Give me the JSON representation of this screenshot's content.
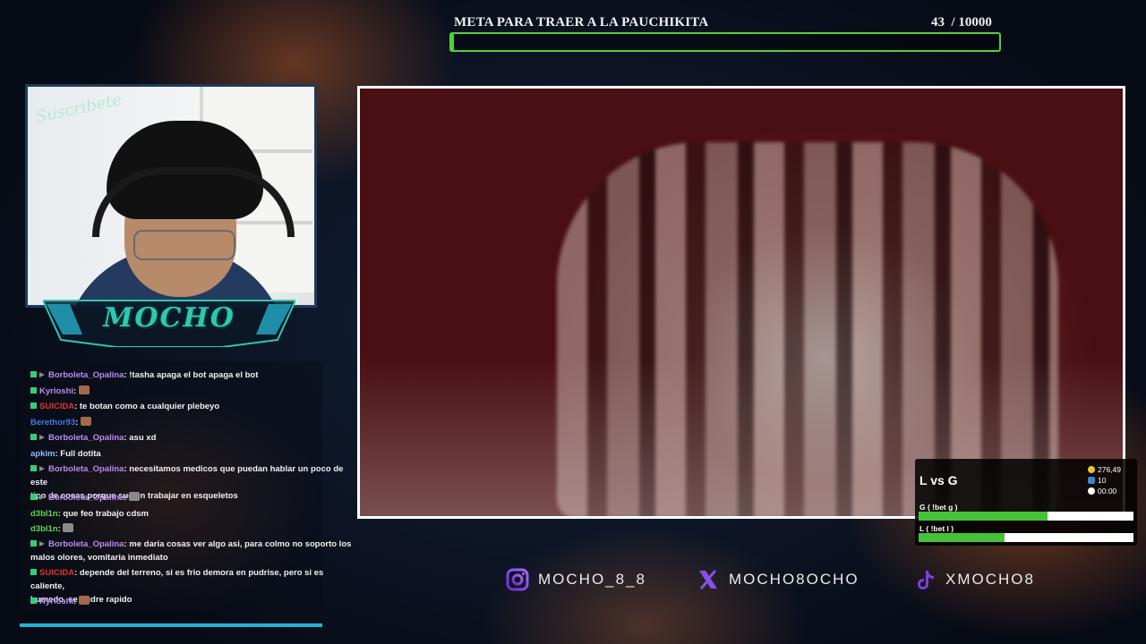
{
  "goal": {
    "title": "META PARA TRAER A LA PAUCHIKITA",
    "current": "43",
    "total": "/ 10000",
    "progress_percent": 0.43,
    "bar_color": "#4fd23a"
  },
  "webcam": {
    "overlay_text": "Suscribete",
    "logo": "MOCHO"
  },
  "chat": {
    "messages": [
      {
        "user": "Borboleta_Opalina",
        "color": "#b98cf2",
        "text": ": !tasha apaga el bot apaga el bot",
        "badges": 2
      },
      {
        "user": "Kyrioshi",
        "color": "#b98cf2",
        "text": ":",
        "emote": true,
        "badges": 1
      },
      {
        "user": "SUICIDA",
        "color": "#e63131",
        "text": ": te botan como a cualquier plebeyo",
        "badges": 1
      },
      {
        "user": "Berethor93",
        "color": "#3d7be0",
        "text": ":",
        "emote": true,
        "badges": 0
      },
      {
        "user": "Borboleta_Opalina",
        "color": "#b98cf2",
        "text": ": asu xd",
        "badges": 2
      },
      {
        "user": "apkim",
        "color": "#8fb7ff",
        "text": ": Full dotita",
        "badges": 0
      },
      {
        "user": "Borboleta_Opalina",
        "color": "#b98cf2",
        "text": ": necesitamos medicos que puedan hablar un poco de este",
        "cont": "tipo de cosas porque suelen trabajar en esqueletos",
        "badges": 2
      },
      {
        "user": "Borboleta_Opalina",
        "color": "#b98cf2",
        "text": ":",
        "emote": true,
        "badges": 2
      },
      {
        "user": "d3bl1n",
        "color": "#62d94f",
        "text": ": que feo trabajo cdsm",
        "badges": 0
      },
      {
        "user": "d3bl1n",
        "color": "#62d94f",
        "text": ":",
        "emote": true,
        "badges": 0
      },
      {
        "user": "Borboleta_Opalina",
        "color": "#b98cf2",
        "text": ": me daría cosas ver algo asi, para colmo no soporto los",
        "cont": "malos olores, vomitaria inmediato",
        "badges": 2
      },
      {
        "user": "SUICIDA",
        "color": "#e63131",
        "text": ": depende del terreno, si es frio demora en pudrise, pero si es caliente,",
        "cont": "humedo, se pudre rapido",
        "badges": 1
      },
      {
        "user": "Kyrioshi",
        "color": "#b98cf2",
        "text": ":",
        "emote": true,
        "badges": 1
      }
    ]
  },
  "bet": {
    "title": "L vs G",
    "points": "276,49",
    "users": "10",
    "time": "00:00",
    "options": [
      {
        "label": "G ( !bet g )",
        "fill": 0.6
      },
      {
        "label": "L ( !bet l )",
        "fill": 0.4
      }
    ]
  },
  "socials": [
    {
      "icon": "instagram-icon",
      "handle": "MOCHO_8_8"
    },
    {
      "icon": "x-icon",
      "handle": "MOCHO8OCHO"
    },
    {
      "icon": "tiktok-icon",
      "handle": "XMOCHO8"
    }
  ]
}
